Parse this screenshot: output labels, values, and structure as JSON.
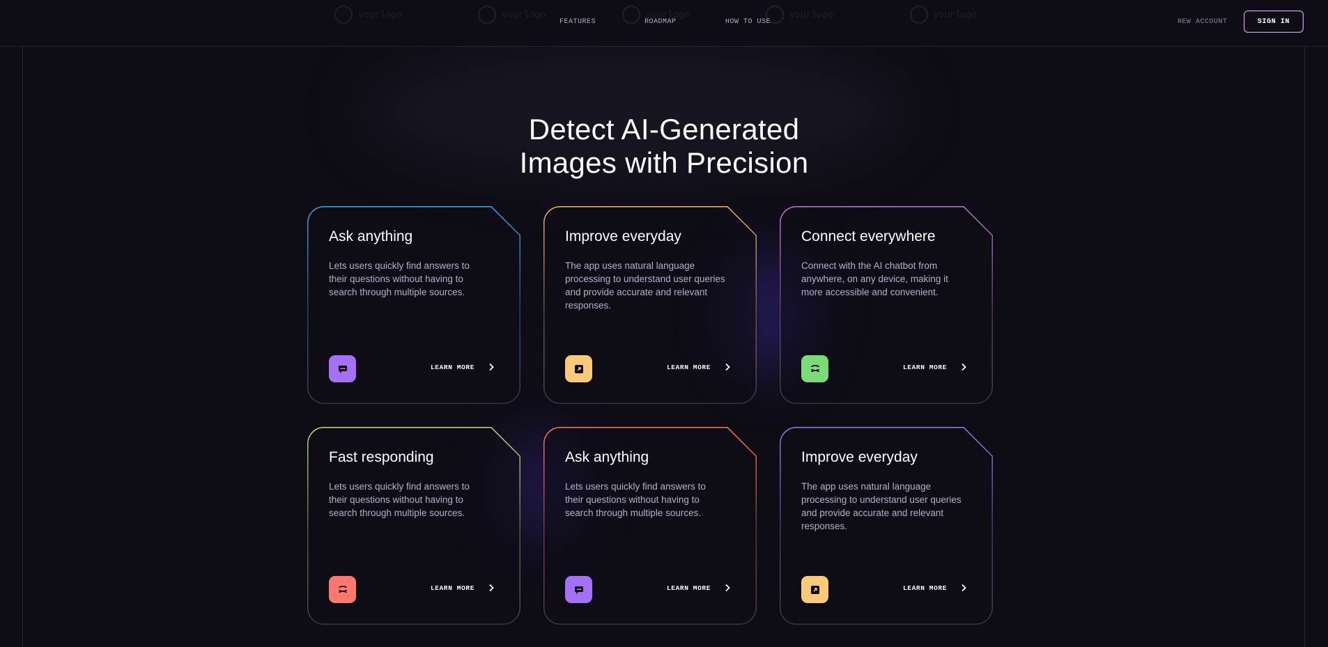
{
  "nav": {
    "links": [
      "FEATURES",
      "ROADMAP",
      "HOW TO USE"
    ],
    "new_account": "NEW ACCOUNT",
    "sign_in": "SIGN IN"
  },
  "ghost_logos": [
    "yourlogo",
    "yourlogo",
    "yourlogo",
    "yourlogo",
    "yourlogo"
  ],
  "hero": {
    "title_line1": "Detect AI-Generated",
    "title_line2": "Images with Precision"
  },
  "cards": [
    {
      "title": "Ask anything",
      "text": "Lets users quickly find answers to their questions without having to search through multiple sources.",
      "icon": "chat-icon",
      "icon_bg": "#a470f5",
      "accent": "#3ea8e0",
      "link": "LEARN MORE"
    },
    {
      "title": "Improve everyday",
      "text": "The app uses natural language processing to understand user queries and provide accurate and relevant responses.",
      "icon": "expand-icon",
      "icon_bg": "#fbc97a",
      "accent": "#f1b26d",
      "link": "LEARN MORE"
    },
    {
      "title": "Connect everywhere",
      "text": "Connect with the AI chatbot from anywhere, on any device, making it more accessible and convenient.",
      "icon": "stack-icon",
      "icon_bg": "#7adb78",
      "accent": "#c17ad6",
      "link": "LEARN MORE"
    },
    {
      "title": "Fast responding",
      "text": "Lets users quickly find answers to their questions without having to search through multiple sources.",
      "icon": "stack-icon",
      "icon_bg": "#ff776f",
      "accent": "#b9e27a",
      "link": "LEARN MORE"
    },
    {
      "title": "Ask anything",
      "text": "Lets users quickly find answers to their questions without having to search through multiple sources.",
      "icon": "chat-icon",
      "icon_bg": "#a470f5",
      "accent": "#ff7a5c",
      "link": "LEARN MORE"
    },
    {
      "title": "Improve everyday",
      "text": "The app uses natural language processing to understand user queries and provide accurate and relevant responses.",
      "icon": "expand-icon",
      "icon_bg": "#fbc97a",
      "accent": "#8a83f0",
      "link": "LEARN MORE"
    }
  ]
}
